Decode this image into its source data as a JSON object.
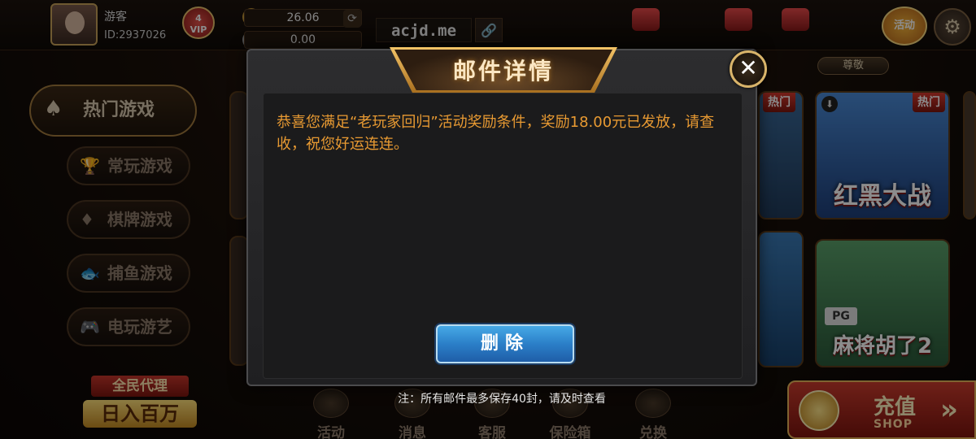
{
  "header": {
    "username": "游客",
    "user_id": "ID:2937026",
    "vip_level": "4",
    "vip_label": "VIP",
    "balance": "26.06",
    "bank_balance": "0.00",
    "site": "acjd.me"
  },
  "top_icons": {
    "activity": "活动"
  },
  "lobby": {
    "honored_label": "尊敬"
  },
  "sidebar": {
    "items": [
      {
        "label": "热门游戏",
        "icon": "♠"
      },
      {
        "label": "常玩游戏",
        "icon": "🏆"
      },
      {
        "label": "棋牌游戏",
        "icon": "♦"
      },
      {
        "label": "捕鱼游戏",
        "icon": "🐟"
      },
      {
        "label": "电玩游艺",
        "icon": "🎮"
      }
    ]
  },
  "agent_promo": {
    "line1": "全民代理",
    "line2": "日入百万"
  },
  "bottom_nav": {
    "items": [
      {
        "label": "活动"
      },
      {
        "label": "消息"
      },
      {
        "label": "客服"
      },
      {
        "label": "保险箱"
      },
      {
        "label": "兑换"
      }
    ]
  },
  "recharge": {
    "label": "充值",
    "sub": "SHOP"
  },
  "games": [
    {
      "title": "红黑大战",
      "badge": "热门"
    },
    {
      "title": "麻将胡了2",
      "badge": "",
      "provider": "PG"
    }
  ],
  "modal": {
    "title": "邮件详情",
    "message": "恭喜您满足“老玩家回归”活动奖励条件，奖励18.00元已发放，请查收，祝您好运连连。",
    "delete_label": "删除",
    "note": "注：所有邮件最多保存40封，请及时查看"
  },
  "colors": {
    "message_text": "#e89a32",
    "title_gold": "#f4c467",
    "delete_blue": "#2b7fc8"
  },
  "icons": [
    "close-icon",
    "refresh-icon",
    "link-icon",
    "settings-icon",
    "coin-icon",
    "spade-icon",
    "trophy-icon",
    "card-icon",
    "fish-icon",
    "gamepad-icon",
    "download-icon"
  ]
}
